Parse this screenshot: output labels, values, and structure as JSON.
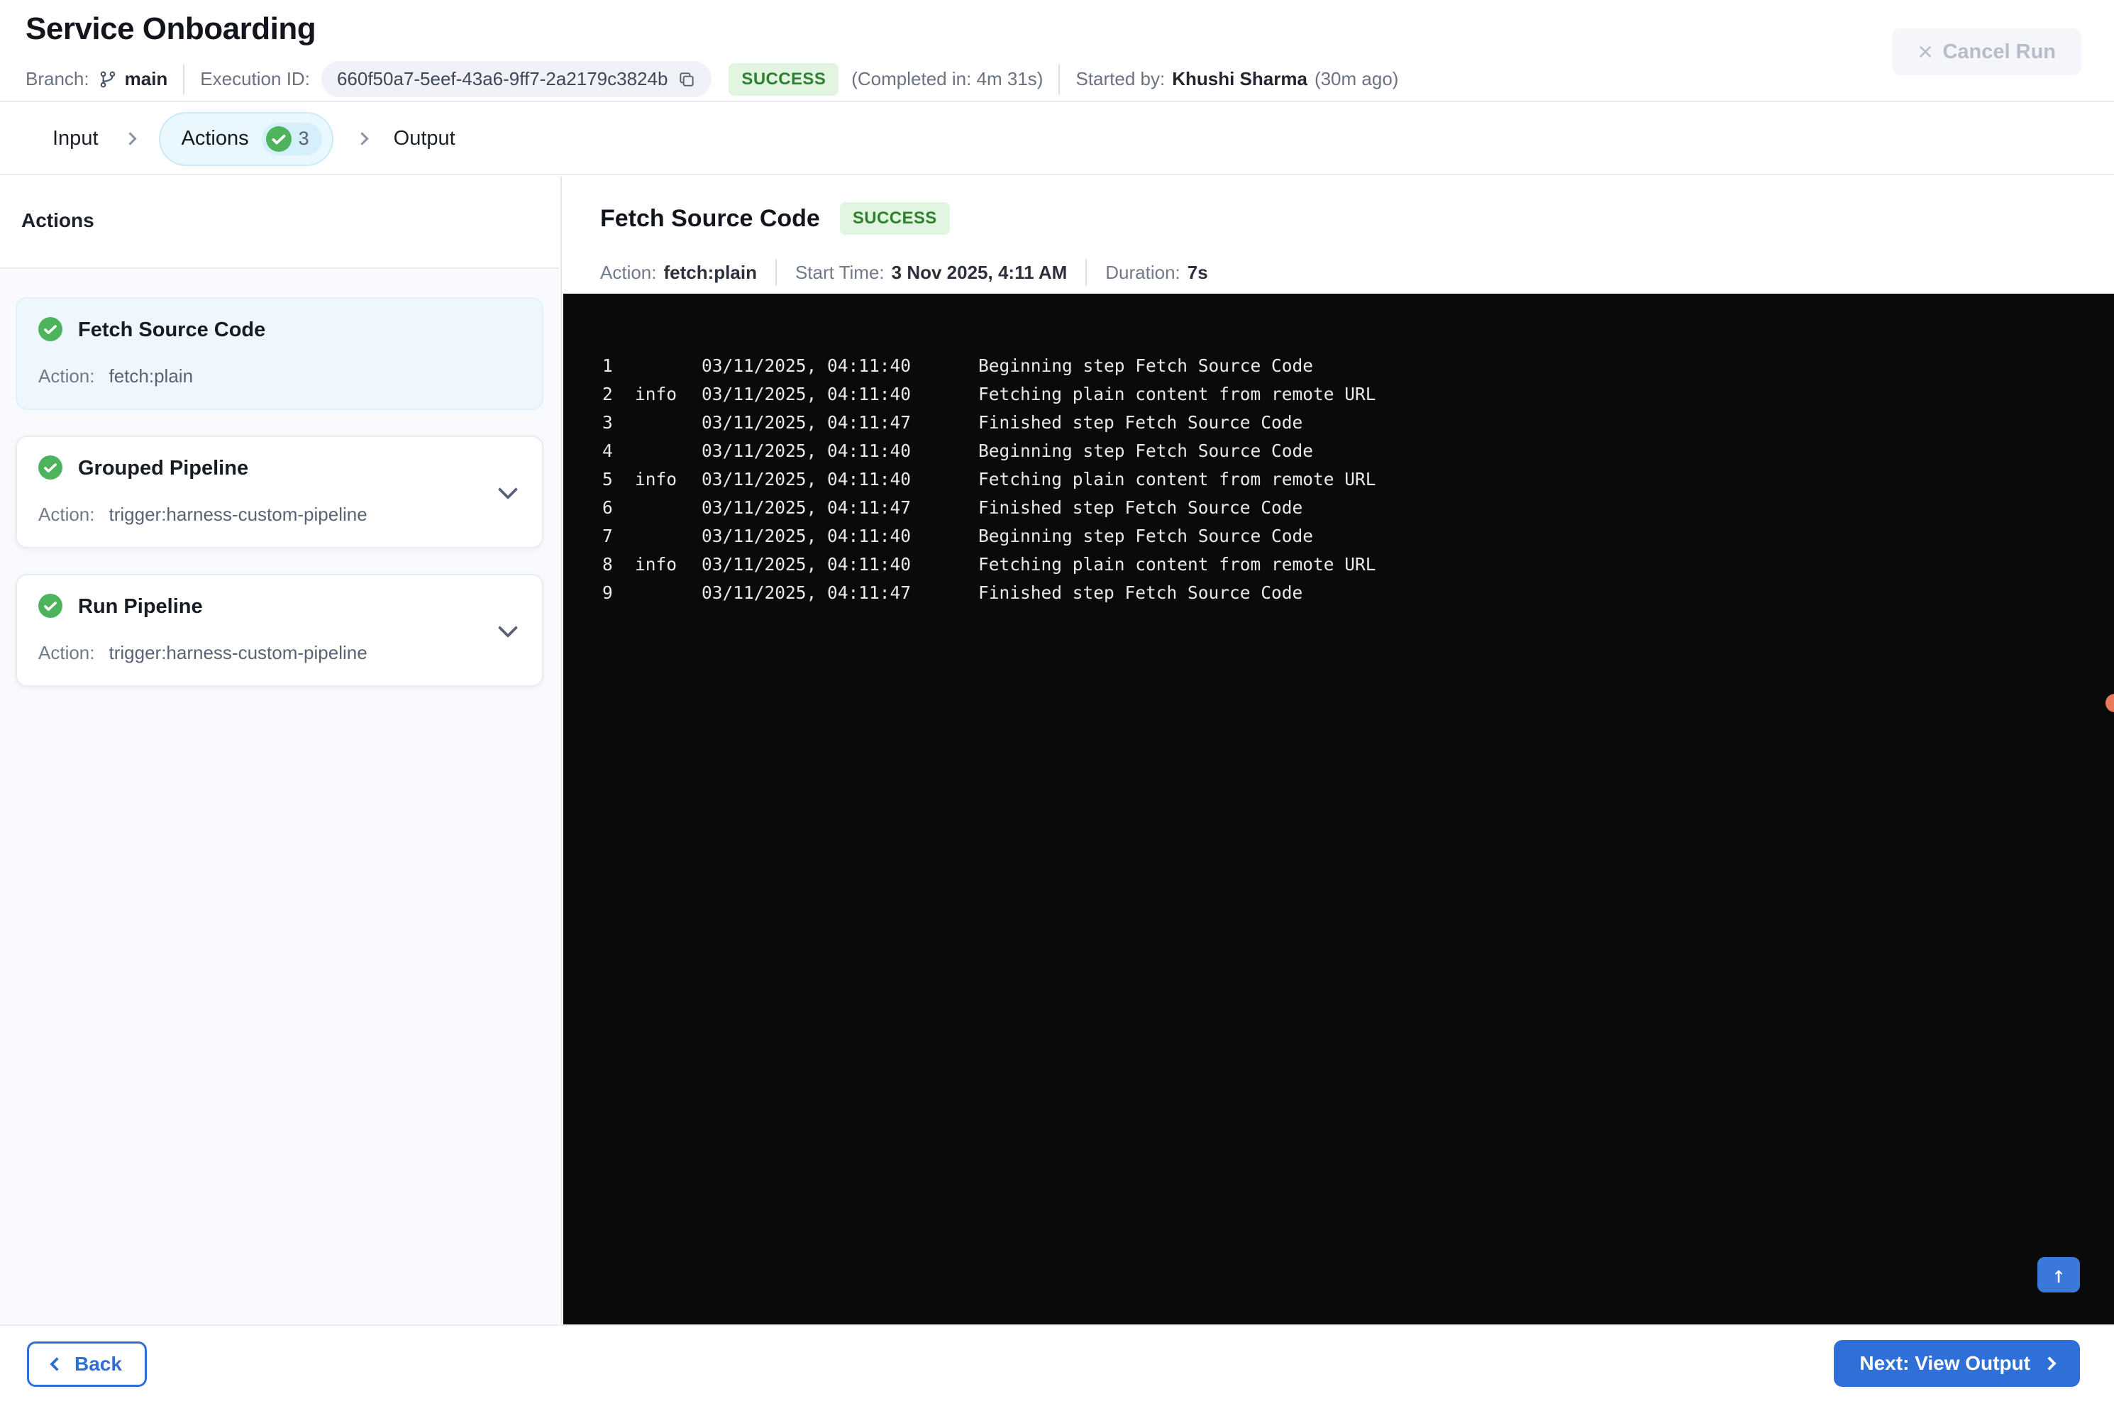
{
  "header": {
    "title": "Service Onboarding",
    "branch_label": "Branch:",
    "branch": "main",
    "execution_id_label": "Execution ID:",
    "execution_id": "660f50a7-5eef-43a6-9ff7-2a2179c3824b",
    "status": "SUCCESS",
    "completed": "(Completed in: 4m 31s)",
    "started_by_label": "Started by:",
    "started_by": "Khushi Sharma",
    "started_ago": "(30m ago)",
    "cancel_label": "Cancel Run"
  },
  "tabs": {
    "input": "Input",
    "actions": "Actions",
    "actions_count": "3",
    "output": "Output"
  },
  "sidebar": {
    "heading": "Actions",
    "action_label": "Action:",
    "cards": [
      {
        "title": "Fetch Source Code",
        "action": "fetch:plain",
        "selected": true,
        "expandable": false
      },
      {
        "title": "Grouped Pipeline",
        "action": "trigger:harness-custom-pipeline",
        "selected": false,
        "expandable": true
      },
      {
        "title": "Run Pipeline",
        "action": "trigger:harness-custom-pipeline",
        "selected": false,
        "expandable": true
      }
    ]
  },
  "detail": {
    "title": "Fetch Source Code",
    "status": "SUCCESS",
    "action_label": "Action:",
    "action": "fetch:plain",
    "start_label": "Start Time:",
    "start": "3 Nov 2025, 4:11 AM",
    "duration_label": "Duration:",
    "duration": "7s"
  },
  "console": {
    "lines": [
      {
        "n": "1",
        "level": "",
        "ts": "03/11/2025, 04:11:40",
        "msg": "Beginning step Fetch Source Code"
      },
      {
        "n": "2",
        "level": "info",
        "ts": "03/11/2025, 04:11:40",
        "msg": "Fetching plain content from remote URL"
      },
      {
        "n": "3",
        "level": "",
        "ts": "03/11/2025, 04:11:47",
        "msg": "Finished step Fetch Source Code"
      },
      {
        "n": "4",
        "level": "",
        "ts": "03/11/2025, 04:11:40",
        "msg": "Beginning step Fetch Source Code"
      },
      {
        "n": "5",
        "level": "info",
        "ts": "03/11/2025, 04:11:40",
        "msg": "Fetching plain content from remote URL"
      },
      {
        "n": "6",
        "level": "",
        "ts": "03/11/2025, 04:11:47",
        "msg": "Finished step Fetch Source Code"
      },
      {
        "n": "7",
        "level": "",
        "ts": "03/11/2025, 04:11:40",
        "msg": "Beginning step Fetch Source Code"
      },
      {
        "n": "8",
        "level": "info",
        "ts": "03/11/2025, 04:11:40",
        "msg": "Fetching plain content from remote URL"
      },
      {
        "n": "9",
        "level": "",
        "ts": "03/11/2025, 04:11:47",
        "msg": "Finished step Fetch Source Code"
      }
    ]
  },
  "footer": {
    "back": "Back",
    "next": "Next: View Output"
  },
  "icons": {
    "cancel_x": "×",
    "up_arrow": "↑"
  },
  "colors": {
    "primary_blue": "#2e6fd7",
    "success_check_green": "#4db35d",
    "success_badge_bg": "#e2f5e1",
    "success_badge_text": "#2f8132",
    "active_tab_bg": "#e9f8fe",
    "active_tab_border": "#cdeaf6",
    "console_bg": "#0a0a0b",
    "orange_dot": "#e8795c"
  }
}
